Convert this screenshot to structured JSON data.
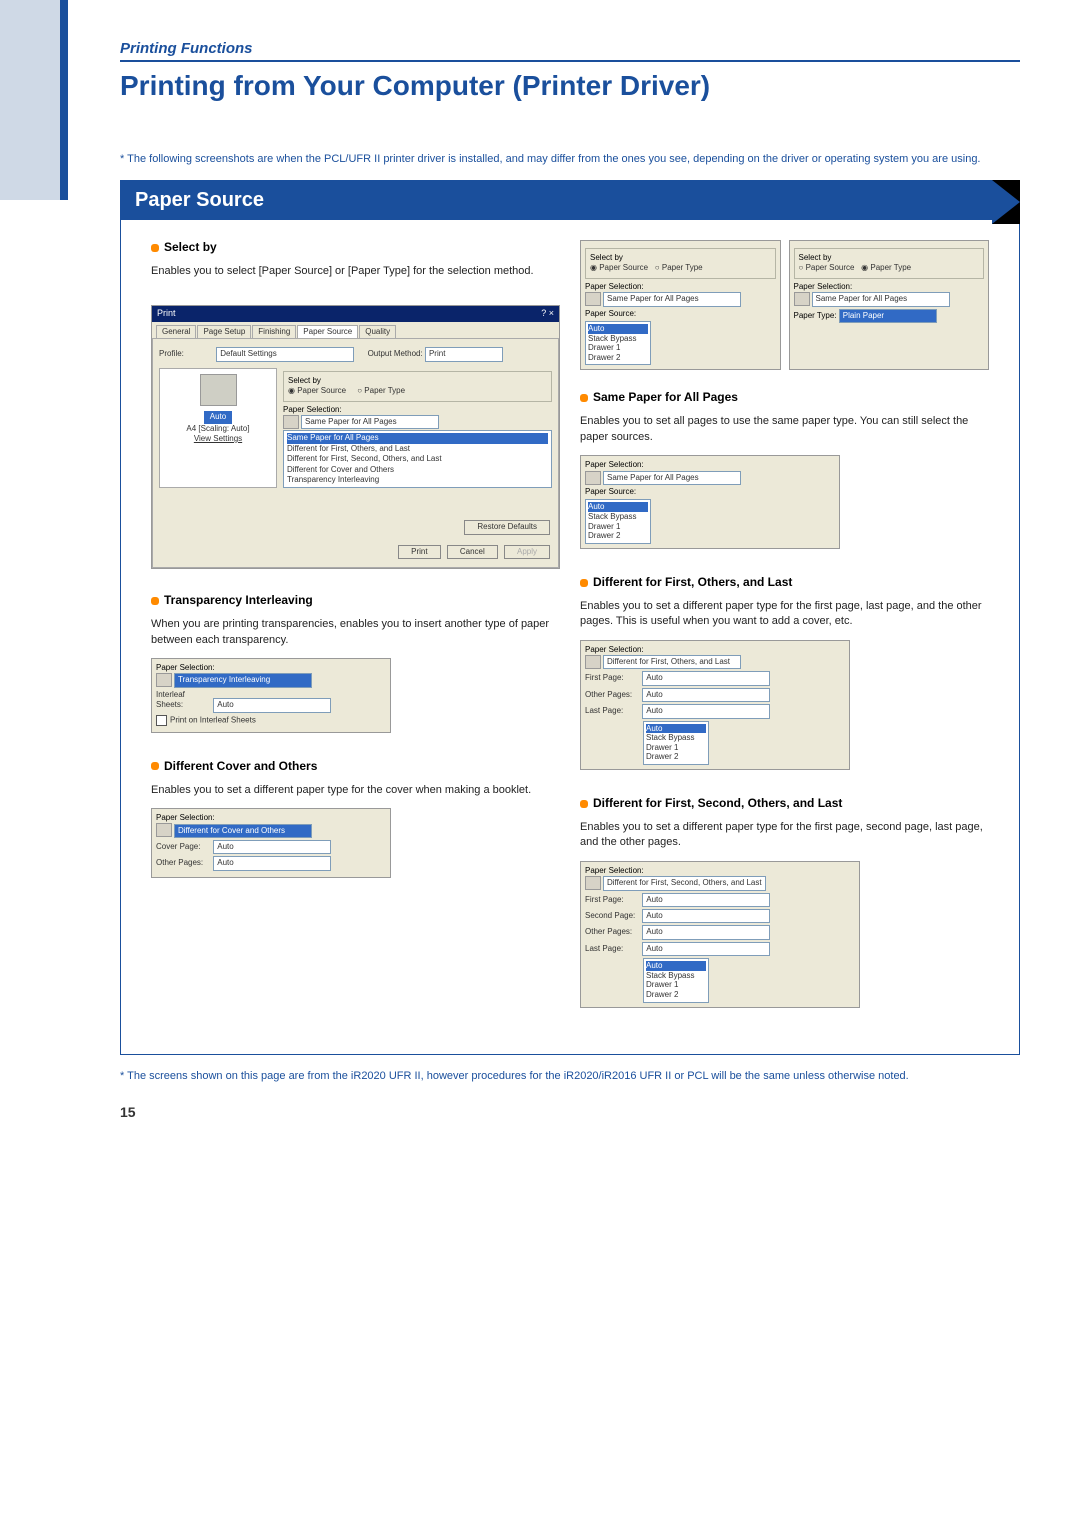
{
  "header": {
    "section": "Printing Functions",
    "title": "Printing from Your Computer (Printer Driver)"
  },
  "top_note": "* The following screenshots are when the PCL/UFR II printer driver is installed, and may differ from the ones you see, depending on the driver or operating system you are using.",
  "box_title": "Paper Source",
  "footer_note": "* The screens shown on this page are from the iR2020 UFR II, however procedures for the iR2020/iR2016 UFR II or PCL will be the same unless otherwise noted.",
  "page_number": "15",
  "select_by": {
    "title": "Select by",
    "desc": "Enables you to select [Paper Source] or [Paper Type] for the selection method.",
    "group_label": "Select by",
    "opt1": "Paper Source",
    "opt2": "Paper Type",
    "ps_label": "Paper Selection:",
    "ps_value": "Same Paper for All Pages",
    "src_label": "Paper Source:",
    "list": [
      "Auto",
      "Stack Bypass",
      "Drawer 1",
      "Drawer 2"
    ],
    "pt_label": "Paper Type:",
    "pt_value": "Plain Paper"
  },
  "same_paper": {
    "title": "Same Paper for All Pages",
    "desc": "Enables you to set all pages to use the same paper type. You can still select the paper sources.",
    "ps_label": "Paper Selection:",
    "ps_value": "Same Paper for All Pages",
    "src_label": "Paper Source:",
    "list": [
      "Auto",
      "Stack Bypass",
      "Drawer 1",
      "Drawer 2"
    ]
  },
  "main_dialog": {
    "title": "Print",
    "close": "? ×",
    "tabs": [
      "General",
      "Page Setup",
      "Finishing",
      "Paper Source",
      "Quality"
    ],
    "profile_label": "Profile:",
    "profile_value": "Default Settings",
    "output_label": "Output Method:",
    "output_value": "Print",
    "group_label": "Select by",
    "opt1": "Paper Source",
    "opt2": "Paper Type",
    "ps_label": "Paper Selection:",
    "ps_value": "Same Paper for All Pages",
    "ps_items": [
      "Same Paper for All Pages",
      "Different for First, Others, and Last",
      "Different for First, Second, Others, and Last",
      "Different for Cover and Others",
      "Transparency Interleaving"
    ],
    "a4_label": "A4 [Scaling: Auto]",
    "auto": "Auto",
    "view_settings": "View Settings",
    "restore": "Restore Defaults",
    "print": "Print",
    "cancel": "Cancel",
    "apply": "Apply"
  },
  "different_fol": {
    "title": "Different for First, Others, and Last",
    "desc": "Enables you to set a different paper type for the first page, last page, and the other pages. This is useful when you want to add a cover, etc.",
    "ps_label": "Paper Selection:",
    "ps_value": "Different for First, Others, and Last",
    "first": "First Page:",
    "other": "Other Pages:",
    "last": "Last Page:",
    "auto": "Auto",
    "list": [
      "Auto",
      "Stack Bypass",
      "Drawer 1",
      "Drawer 2"
    ]
  },
  "transparency": {
    "title": "Transparency Interleaving",
    "desc": "When you are printing transparencies, enables you to insert another type of paper between each transparency.",
    "ps_label": "Paper Selection:",
    "ps_value": "Transparency Interleaving",
    "interleaf": "Interleaf Sheets:",
    "auto": "Auto",
    "print_on": "Print on Interleaf Sheets"
  },
  "different_fsol": {
    "title": "Different for First, Second, Others, and Last",
    "desc": "Enables you to set a different paper type for the first page, second page, last page, and the other pages.",
    "ps_label": "Paper Selection:",
    "ps_value": "Different for First, Second, Others, and Last",
    "first": "First Page:",
    "second": "Second Page:",
    "other": "Other Pages:",
    "last": "Last Page:",
    "auto": "Auto",
    "list": [
      "Auto",
      "Stack Bypass",
      "Drawer 1",
      "Drawer 2"
    ]
  },
  "different_cover": {
    "title": "Different Cover and Others",
    "desc": "Enables you to set a different paper type for the cover when making a booklet.",
    "ps_label": "Paper Selection:",
    "ps_value": "Different for Cover and Others",
    "cover": "Cover Page:",
    "other": "Other Pages:",
    "auto": "Auto"
  }
}
